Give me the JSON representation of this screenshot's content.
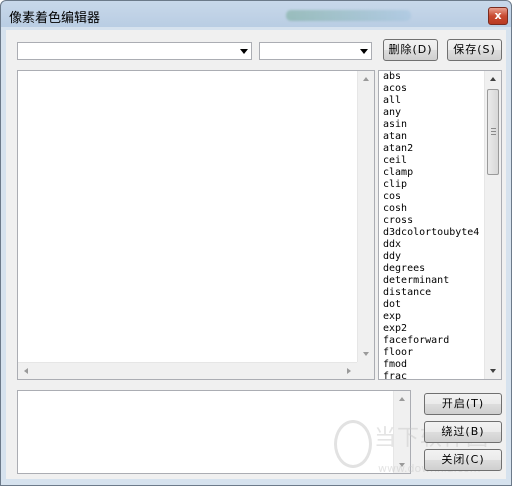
{
  "window": {
    "title": "像素着色编辑器",
    "close_glyph": "x"
  },
  "toolbar": {
    "combo1_value": "",
    "combo2_value": "",
    "delete_label": "删除(D)",
    "save_label": "保存(S)"
  },
  "function_list": {
    "items": [
      "abs",
      "acos",
      "all",
      "any",
      "asin",
      "atan",
      "atan2",
      "ceil",
      "clamp",
      "clip",
      "cos",
      "cosh",
      "cross",
      "d3dcolortoubyte4",
      "ddx",
      "ddy",
      "degrees",
      "determinant",
      "distance",
      "dot",
      "exp",
      "exp2",
      "faceforward",
      "floor",
      "fmod",
      "frac"
    ]
  },
  "buttons": {
    "open_label": "开启(T)",
    "skip_label": "绕过(B)",
    "close_label": "关闭(C)"
  },
  "watermark": {
    "text": "当下软件园",
    "url": "www.downxia.com"
  }
}
